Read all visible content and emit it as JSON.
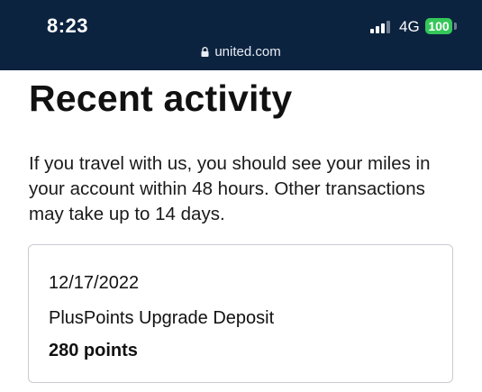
{
  "status_bar": {
    "time": "8:23",
    "network": "4G",
    "battery": "100",
    "signal_bars_active": 3,
    "signal_bars_total": 4,
    "background_color": "#0c2340",
    "battery_color": "#34c759",
    "url": "united.com",
    "lock_icon": "lock-icon"
  },
  "main": {
    "title": "Recent activity",
    "intro": "If you travel with us, you should see your miles in your account within 48 hours. Other transactions may take up to 14 days."
  },
  "activity": [
    {
      "date": "12/17/2022",
      "description": "PlusPoints Upgrade Deposit",
      "amount": "280 points"
    }
  ]
}
